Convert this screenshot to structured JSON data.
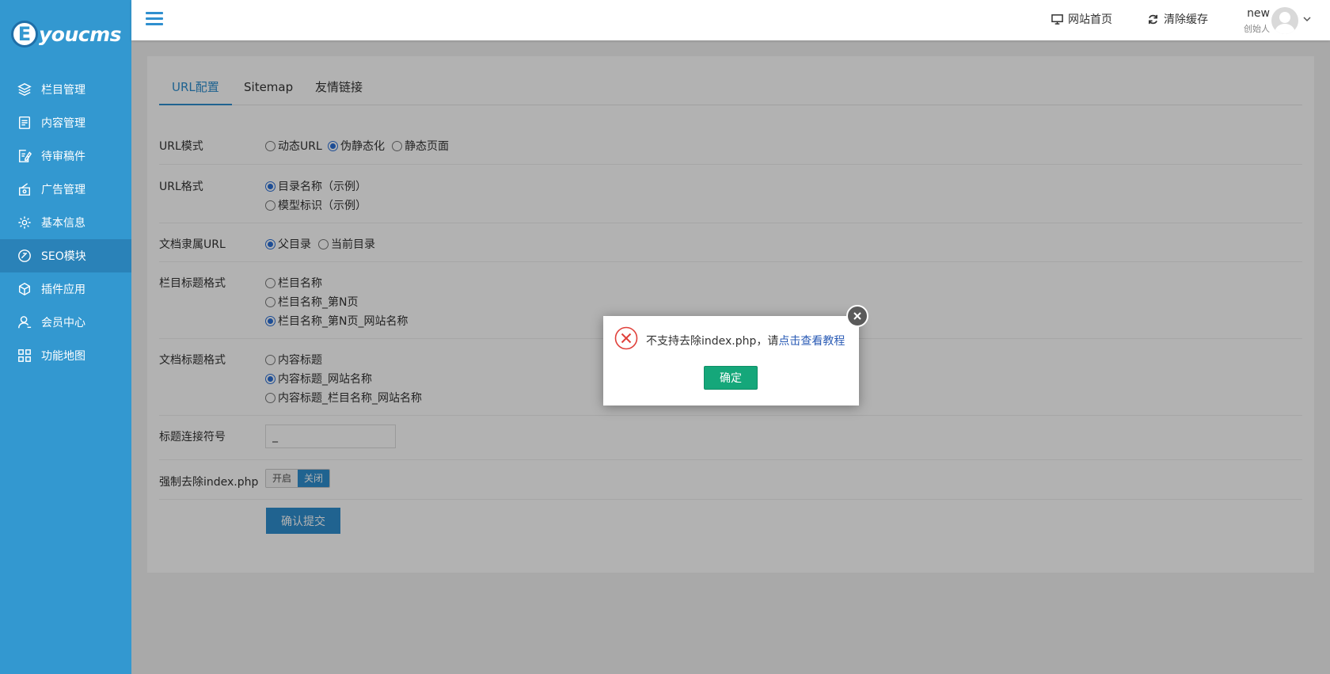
{
  "brand": {
    "badge": "E",
    "name": "youcms"
  },
  "sidebar": {
    "items": [
      {
        "label": "栏目管理",
        "icon": "layers-icon"
      },
      {
        "label": "内容管理",
        "icon": "document-icon"
      },
      {
        "label": "待审稿件",
        "icon": "edit-doc-icon"
      },
      {
        "label": "广告管理",
        "icon": "ad-icon"
      },
      {
        "label": "基本信息",
        "icon": "gear-icon"
      },
      {
        "label": "SEO模块",
        "icon": "seo-icon",
        "active": true
      },
      {
        "label": "插件应用",
        "icon": "cube-icon"
      },
      {
        "label": "会员中心",
        "icon": "user-icon"
      },
      {
        "label": "功能地图",
        "icon": "grid-icon"
      }
    ]
  },
  "header": {
    "home_label": "网站首页",
    "clear_cache_label": "清除缓存",
    "user_name": "new",
    "user_role": "创始人"
  },
  "tabs": [
    {
      "label": "URL配置",
      "active": true
    },
    {
      "label": "Sitemap"
    },
    {
      "label": "友情链接"
    }
  ],
  "form": {
    "url_mode": {
      "label": "URL模式",
      "options": [
        "动态URL",
        "伪静态化",
        "静态页面"
      ],
      "selected": 1
    },
    "url_format": {
      "label": "URL格式",
      "options": [
        "目录名称（示例）",
        "模型标识（示例）"
      ],
      "selected": 0
    },
    "doc_url": {
      "label": "文档隶属URL",
      "options": [
        "父目录",
        "当前目录"
      ],
      "selected": 0
    },
    "cat_title": {
      "label": "栏目标题格式",
      "options": [
        "栏目名称",
        "栏目名称_第N页",
        "栏目名称_第N页_网站名称"
      ],
      "selected": 2
    },
    "doc_title": {
      "label": "文档标题格式",
      "options": [
        "内容标题",
        "内容标题_网站名称",
        "内容标题_栏目名称_网站名称"
      ],
      "selected": 1
    },
    "separator": {
      "label": "标题连接符号",
      "value": "_"
    },
    "force_index": {
      "label": "强制去除index.php",
      "on_label": "开启",
      "off_label": "关闭",
      "value": "关闭"
    },
    "submit_label": "确认提交"
  },
  "dialog": {
    "message": "不支持去除index.php，请",
    "link_text": "点击查看教程",
    "ok_label": "确定"
  },
  "colors": {
    "sidebar": "#3398d0",
    "accent": "#2f8fcf",
    "confirm": "#15a77a"
  }
}
